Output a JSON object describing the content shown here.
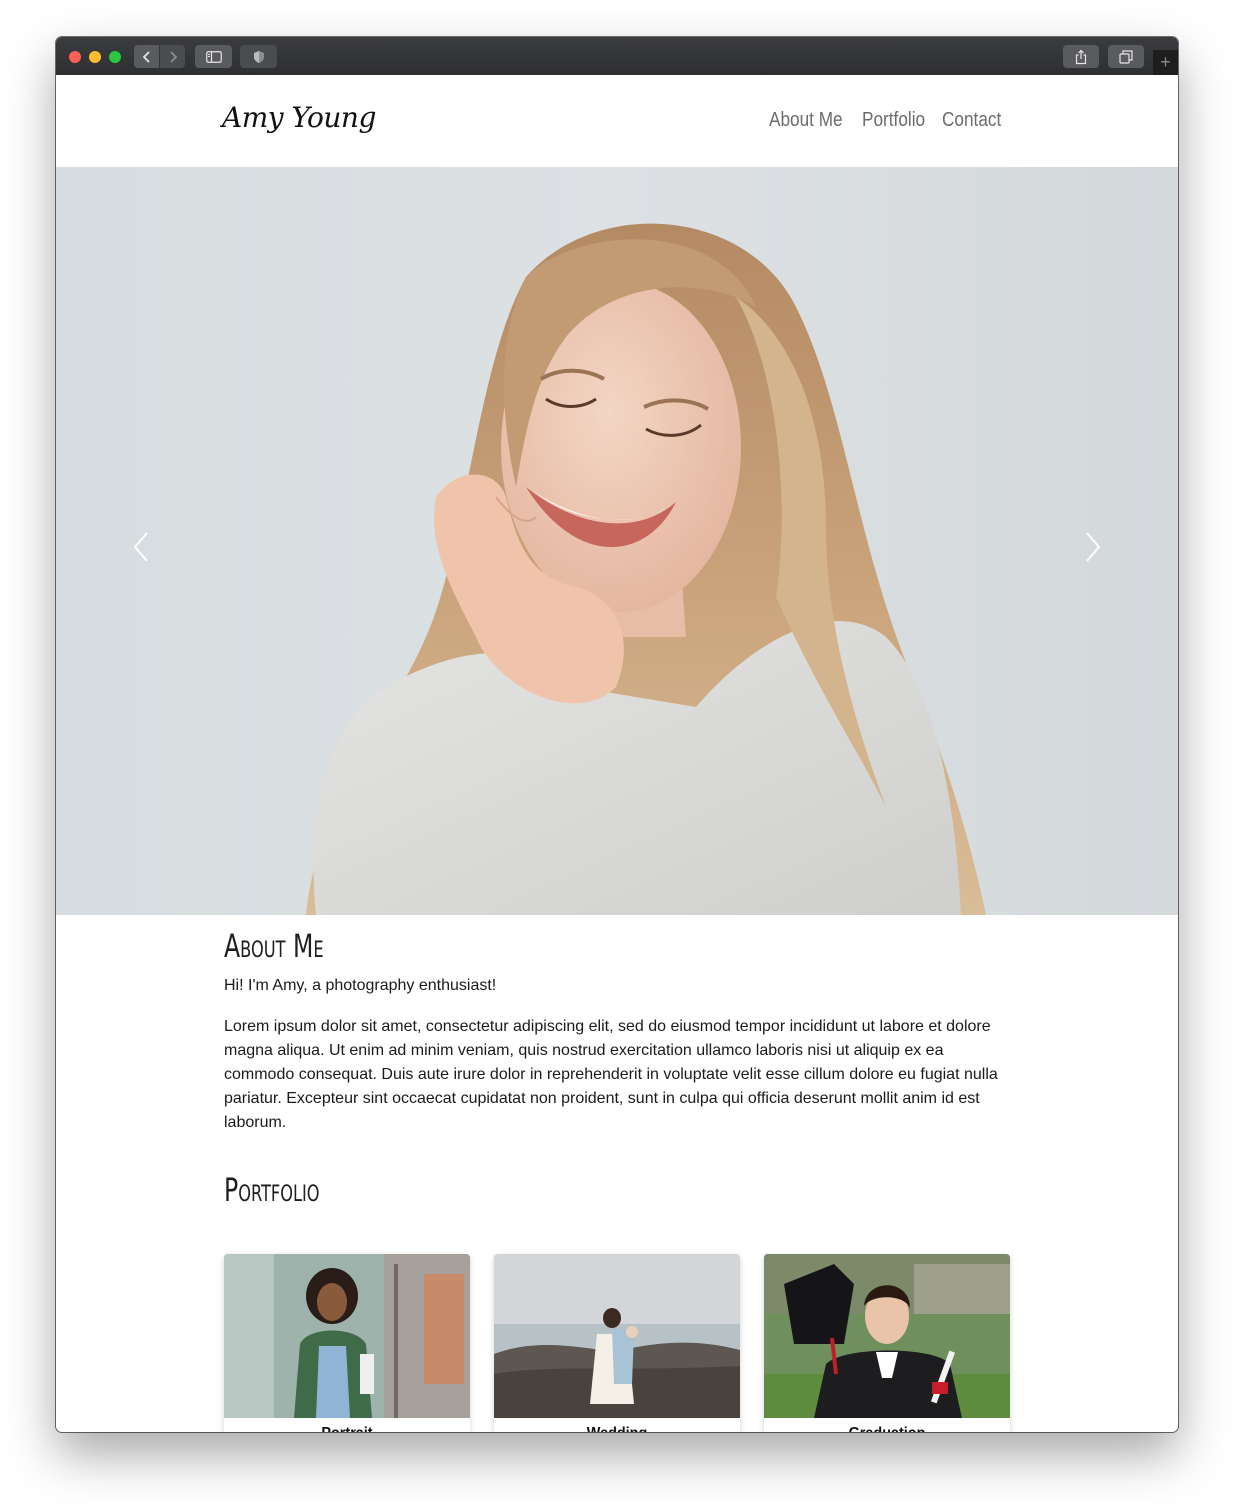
{
  "header": {
    "logo": "Amy Young",
    "nav": [
      "About Me",
      "Portfolio",
      "Contact"
    ]
  },
  "carousel": {
    "prev_icon": "chevron-left-icon",
    "next_icon": "chevron-right-icon"
  },
  "about": {
    "title": "About Me",
    "lead": "Hi! I'm Amy, a photography enthusiast!",
    "body": "Lorem ipsum dolor sit amet, consectetur adipiscing elit, sed do eiusmod tempor incididunt ut labore et dolore magna aliqua. Ut enim ad minim veniam, quis nostrud exercitation ullamco laboris nisi ut aliquip ex ea commodo consequat. Duis aute irure dolor in reprehenderit in voluptate velit esse cillum dolore eu fugiat nulla pariatur. Excepteur sint occaecat cupidatat non proident, sunt in culpa qui officia deserunt mollit anim id est laborum."
  },
  "portfolio": {
    "title": "Portfolio",
    "cards": [
      {
        "label": "Portrait"
      },
      {
        "label": "Wedding"
      },
      {
        "label": "Graduation"
      }
    ]
  }
}
